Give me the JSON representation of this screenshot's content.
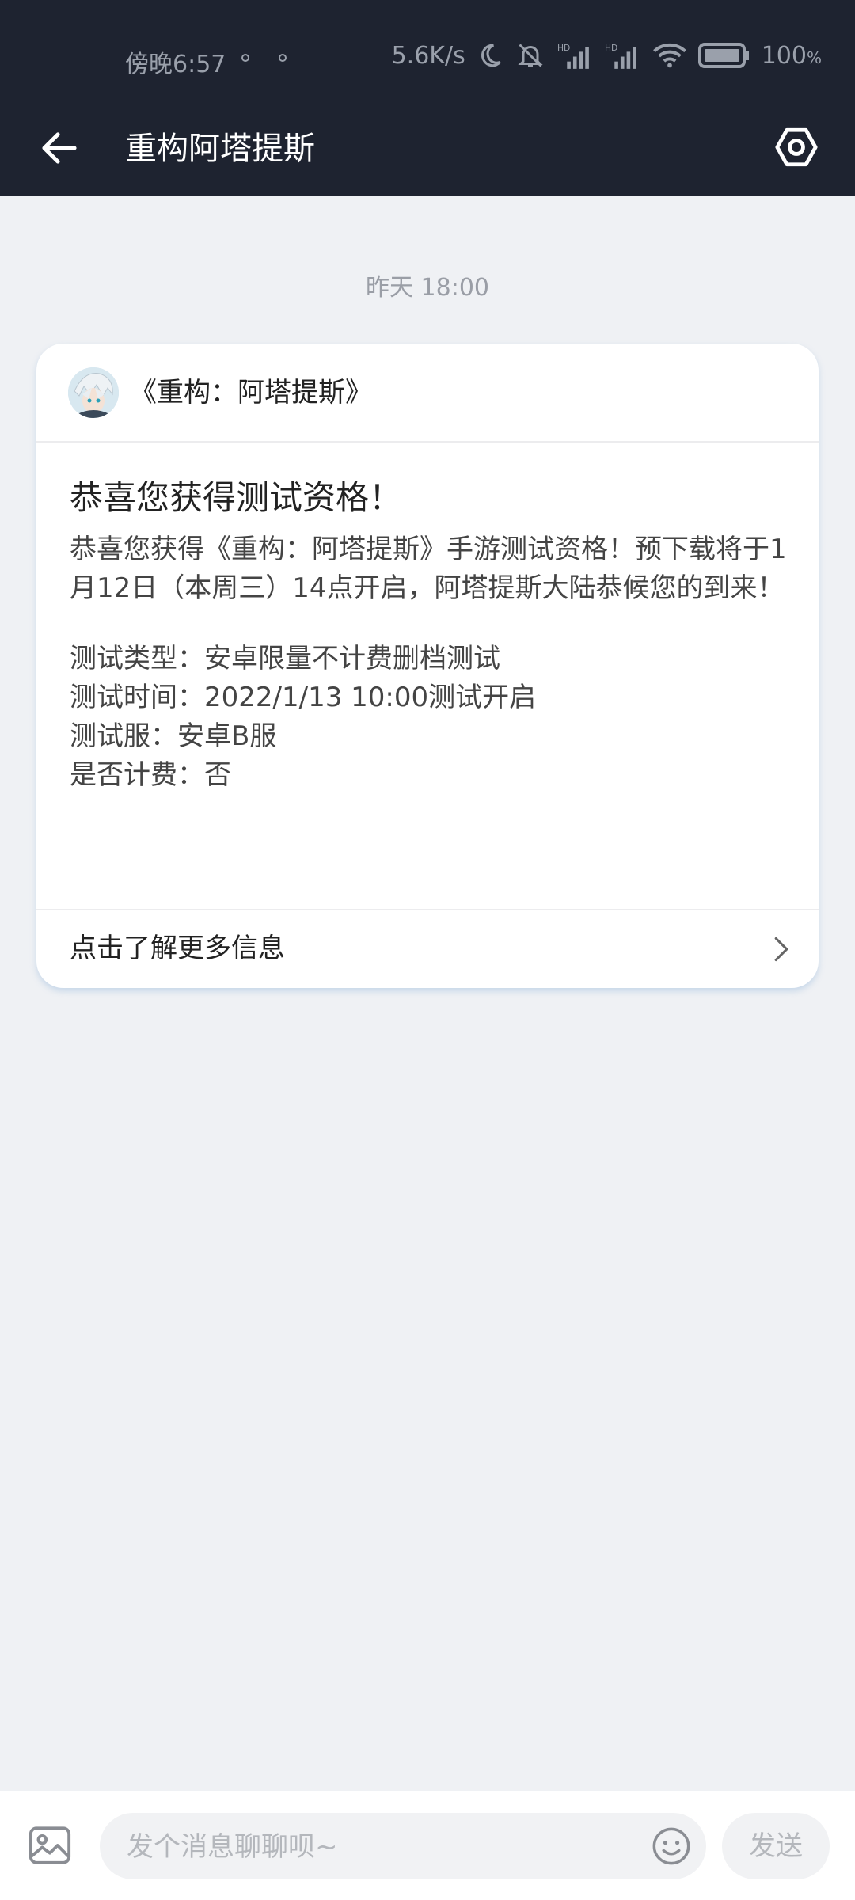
{
  "status_bar": {
    "time": "傍晚6:57",
    "speed": "5.6K/s",
    "battery": "100"
  },
  "header": {
    "title": "重构阿塔提斯",
    "back_icon": "arrow-left-icon",
    "settings_icon": "hexagon-settings-icon"
  },
  "chat": {
    "timestamp": "昨天 18:00",
    "card": {
      "game_name": "《重构：阿塔提斯》",
      "title": "恭喜您获得测试资格！",
      "text": "恭喜您获得《重构：阿塔提斯》手游测试资格！预下载将于1月12日（本周三）14点开启，阿塔提斯大陆恭候您的到来！",
      "details": [
        "测试类型：安卓限量不计费删档测试",
        "测试时间：2022/1/13 10:00测试开启",
        "测试服：安卓B服",
        "是否计费：否"
      ],
      "more_link": "点击了解更多信息"
    }
  },
  "input_bar": {
    "placeholder": "发个消息聊聊呗~",
    "send_label": "发送"
  },
  "colors": {
    "header_bg": "#1e2330",
    "page_bg": "#eff1f4",
    "card_bg": "#ffffff"
  }
}
